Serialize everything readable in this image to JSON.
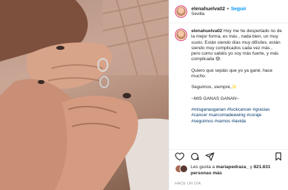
{
  "post": {
    "username": "elenahuelva02",
    "dot": "•",
    "follow_label": "Seguir",
    "location": "Sevilla",
    "caption_lines": [
      "Hoy me he despertado no de la mejor forma, es más , nada bien, un muy susto. Están siendo días muy difíciles, están siendo muy complicados cada vez más , pero como sabéis yo soy más fuerte, y más complicada 😅.",
      "Quiero que sepáis que yo ya gané, hace mucho.",
      "Seguimos, siempre,✨",
      "~MIS GANAS GANAN~",
      "#misganasganan #fuckcancer #gracias #cancer #sarcomadeewing #coraje #seguimos #vamos #lavida"
    ],
    "likes": {
      "prefix": "Les gusta a ",
      "user": "mariapedraza_",
      "middle": " y ",
      "count": "821.831 personas más"
    },
    "timestamp": "HACE UN DÍA"
  }
}
